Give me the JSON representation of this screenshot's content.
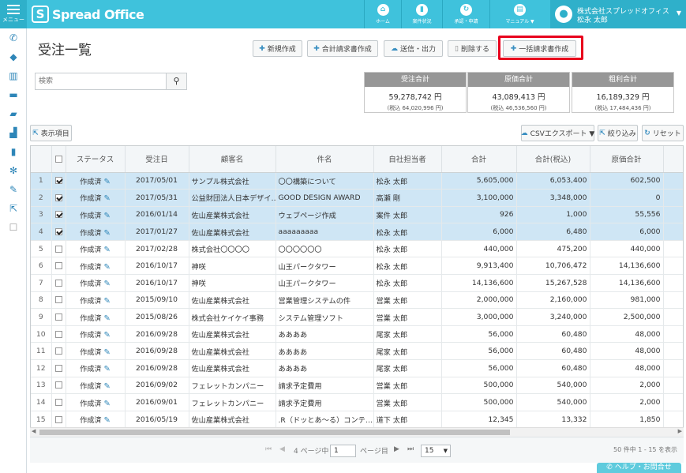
{
  "app": {
    "logo_mark": "S",
    "logo_text": "Spread Office",
    "menu_label": "メニュー"
  },
  "nav": [
    {
      "label": "ホーム",
      "icon": "home-icon",
      "glyph": "⌂"
    },
    {
      "label": "案件状況",
      "icon": "chart-icon",
      "glyph": "▮"
    },
    {
      "label": "承認・申請",
      "icon": "sync-icon",
      "glyph": "↻"
    },
    {
      "label": "マニュアル ▼",
      "icon": "manual-icon",
      "glyph": "▤"
    }
  ],
  "user": {
    "company": "株式会社スプレッドオフィス",
    "name": "松永 太郎"
  },
  "sidebar": [
    {
      "icon": "phone-icon",
      "glyph": "✆"
    },
    {
      "icon": "tag-icon",
      "glyph": "◆"
    },
    {
      "icon": "bar-chart-icon",
      "glyph": "▥"
    },
    {
      "icon": "card-icon",
      "glyph": "▬"
    },
    {
      "icon": "folder-icon",
      "glyph": "▰"
    },
    {
      "icon": "signal-icon",
      "glyph": "▟"
    },
    {
      "icon": "document-icon",
      "glyph": "▮"
    },
    {
      "icon": "gear-icon",
      "glyph": "✻"
    },
    {
      "icon": "wrench-icon",
      "glyph": "✎"
    },
    {
      "icon": "external-link-icon",
      "glyph": "⇱"
    },
    {
      "icon": "checkbox-icon",
      "glyph": "☐"
    }
  ],
  "page": {
    "title": "受注一覧"
  },
  "toolbar": {
    "new": "新規作成",
    "total_invoice": "合計請求書作成",
    "send_output": "送信・出力",
    "delete": "削除する",
    "bulk_invoice": "一括請求書作成"
  },
  "search": {
    "placeholder": "検索"
  },
  "summary": [
    {
      "title": "受注合計",
      "value": "59,278,742 円",
      "sub": "(税込 64,020,996 円)"
    },
    {
      "title": "原価合計",
      "value": "43,089,413 円",
      "sub": "(税込 46,536,560 円)"
    },
    {
      "title": "粗利合計",
      "value": "16,189,329 円",
      "sub": "(税込 17,484,436 円)"
    }
  ],
  "controls": {
    "columns": "表示項目",
    "csv_export": "CSVエクスポート ▼",
    "filter": "絞り込み",
    "reset": "リセット"
  },
  "table": {
    "columns": [
      "",
      "",
      "ステータス",
      "受注日",
      "顧客名",
      "件名",
      "自社担当者",
      "合計",
      "合計(税込)",
      "原価合計"
    ],
    "rows": [
      {
        "no": "1",
        "checked": true,
        "status": "作成済",
        "date": "2017/05/01",
        "customer": "サンプル株式会社",
        "subject": "〇〇構築について",
        "staff": "松永 太郎",
        "total": "5,605,000",
        "total_tax": "6,053,400",
        "cost": "602,500"
      },
      {
        "no": "2",
        "checked": true,
        "status": "作成済",
        "date": "2017/05/31",
        "customer": "公益財団法人日本デザイ…",
        "subject": "GOOD DESIGN AWARD",
        "staff": "高瀬 剛",
        "total": "3,100,000",
        "total_tax": "3,348,000",
        "cost": "0"
      },
      {
        "no": "3",
        "checked": true,
        "status": "作成済",
        "date": "2016/01/14",
        "customer": "佐山産業株式会社",
        "subject": "ウェブページ作成",
        "staff": "案件 太郎",
        "total": "926",
        "total_tax": "1,000",
        "cost": "55,556"
      },
      {
        "no": "4",
        "checked": true,
        "status": "作成済",
        "date": "2017/01/27",
        "customer": "佐山産業株式会社",
        "subject": "aaaaaaaaa",
        "staff": "松永 太郎",
        "total": "6,000",
        "total_tax": "6,480",
        "cost": "6,000"
      },
      {
        "no": "5",
        "checked": false,
        "status": "作成済",
        "date": "2017/02/28",
        "customer": "株式会社〇〇〇〇",
        "subject": "〇〇〇〇〇〇",
        "staff": "松永 太郎",
        "total": "440,000",
        "total_tax": "475,200",
        "cost": "440,000"
      },
      {
        "no": "6",
        "checked": false,
        "status": "作成済",
        "date": "2016/10/17",
        "customer": "神咲",
        "subject": "山王パークタワー",
        "staff": "松永 太郎",
        "total": "9,913,400",
        "total_tax": "10,706,472",
        "cost": "14,136,600"
      },
      {
        "no": "7",
        "checked": false,
        "status": "作成済",
        "date": "2016/10/17",
        "customer": "神咲",
        "subject": "山王パークタワー",
        "staff": "松永 太郎",
        "total": "14,136,600",
        "total_tax": "15,267,528",
        "cost": "14,136,600"
      },
      {
        "no": "8",
        "checked": false,
        "status": "作成済",
        "date": "2015/09/10",
        "customer": "佐山産業株式会社",
        "subject": "営業管理システムの件",
        "staff": "営業 太郎",
        "total": "2,000,000",
        "total_tax": "2,160,000",
        "cost": "981,000"
      },
      {
        "no": "9",
        "checked": false,
        "status": "作成済",
        "date": "2015/08/26",
        "customer": "株式会社ケイケイ事務",
        "subject": "システム管理ソフト",
        "staff": "営業 太郎",
        "total": "3,000,000",
        "total_tax": "3,240,000",
        "cost": "2,500,000"
      },
      {
        "no": "10",
        "checked": false,
        "status": "作成済",
        "date": "2016/09/28",
        "customer": "佐山産業株式会社",
        "subject": "ああああ",
        "staff": "尾家 太郎",
        "total": "56,000",
        "total_tax": "60,480",
        "cost": "48,000"
      },
      {
        "no": "11",
        "checked": false,
        "status": "作成済",
        "date": "2016/09/28",
        "customer": "佐山産業株式会社",
        "subject": "ああああ",
        "staff": "尾家 太郎",
        "total": "56,000",
        "total_tax": "60,480",
        "cost": "48,000"
      },
      {
        "no": "12",
        "checked": false,
        "status": "作成済",
        "date": "2016/09/28",
        "customer": "佐山産業株式会社",
        "subject": "ああああ",
        "staff": "尾家 太郎",
        "total": "56,000",
        "total_tax": "60,480",
        "cost": "48,000"
      },
      {
        "no": "13",
        "checked": false,
        "status": "作成済",
        "date": "2016/09/02",
        "customer": "フェレットカンパニー",
        "subject": "請求予定費用",
        "staff": "営業 太郎",
        "total": "500,000",
        "total_tax": "540,000",
        "cost": "2,000"
      },
      {
        "no": "14",
        "checked": false,
        "status": "作成済",
        "date": "2016/09/01",
        "customer": "フェレットカンパニー",
        "subject": "請求予定費用",
        "staff": "営業 太郎",
        "total": "500,000",
        "total_tax": "540,000",
        "cost": "2,000"
      },
      {
        "no": "15",
        "checked": false,
        "status": "作成済",
        "date": "2016/05/19",
        "customer": "佐山産業株式会社",
        "subject": ".R（ドッとあ〜る）コンテ…",
        "staff": "道下 太郎",
        "total": "12,345",
        "total_tax": "13,332",
        "cost": "1,850"
      }
    ]
  },
  "pager": {
    "page_prefix": "4 ページ中",
    "page_value": "1",
    "page_suffix": "ページ目",
    "per_page": "15",
    "info": "50 件中 1 - 15 を表示"
  },
  "help": {
    "label": "ヘルプ・お問合せ"
  },
  "colors": {
    "accent": "#3fc2dc",
    "selected_row": "#cfe6f5",
    "highlight": "#e8001c"
  }
}
